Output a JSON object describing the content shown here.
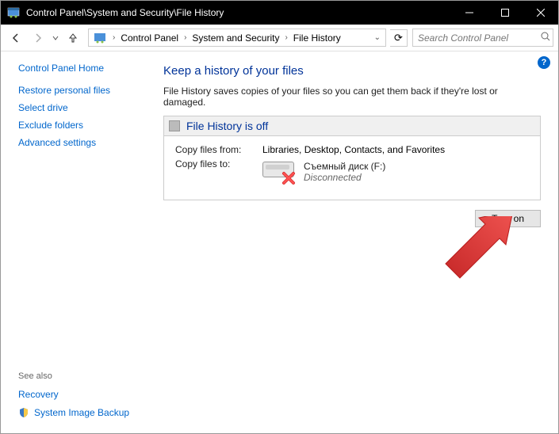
{
  "titlebar": {
    "title": "Control Panel\\System and Security\\File History"
  },
  "breadcrumb": {
    "items": [
      "Control Panel",
      "System and Security",
      "File History"
    ]
  },
  "search": {
    "placeholder": "Search Control Panel"
  },
  "sidebar": {
    "home": "Control Panel Home",
    "links": [
      "Restore personal files",
      "Select drive",
      "Exclude folders",
      "Advanced settings"
    ],
    "see_also": "See also",
    "bottom_links": [
      "Recovery",
      "System Image Backup"
    ]
  },
  "main": {
    "heading": "Keep a history of your files",
    "description": "File History saves copies of your files so you can get them back if they're lost or damaged.",
    "status_title": "File History is off",
    "copy_from_label": "Copy files from:",
    "copy_from_value": "Libraries, Desktop, Contacts, and Favorites",
    "copy_to_label": "Copy files to:",
    "drive_name": "Съемный диск (F:)",
    "drive_status": "Disconnected",
    "turn_on": "Turn on"
  }
}
